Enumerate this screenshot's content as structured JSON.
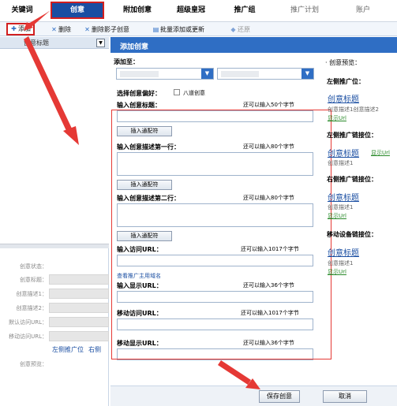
{
  "tabs": [
    {
      "label": "关键词"
    },
    {
      "label": "创意"
    },
    {
      "label": "附加创意"
    },
    {
      "label": "超级皇冠"
    },
    {
      "label": "推广组"
    },
    {
      "label": "推广计划"
    },
    {
      "label": "账户"
    }
  ],
  "toolbar": {
    "add": "添加",
    "delete": "删除",
    "delete_shadow": "删除影子创意",
    "batch": "批量添加或更新",
    "restore": "还原"
  },
  "left_panel": {
    "column_header": "创意标题",
    "form_labels": [
      "创意状态：",
      "创意标题：",
      "创意描述1：",
      "创意描述2：",
      "默认访问URL：",
      "移动访问URL："
    ],
    "tab_left": "左侧推广位",
    "tab_right": "右侧",
    "preview_label": "创意预览："
  },
  "modal": {
    "title": "添加创意",
    "add_to": "添加至：",
    "preference_label": "选择创意偏好：",
    "preference_option": "八道创意",
    "title_label": "输入创意标题：",
    "title_hint": "还可以输入50个字节",
    "insert_wildcard": "插入通配符",
    "desc1_label": "输入创意描述第一行：",
    "desc1_hint": "还可以输入80个字节",
    "desc2_label": "输入创意描述第二行：",
    "desc2_hint": "还可以输入80个字节",
    "visit_url_label": "输入访问URL：",
    "visit_url_hint": "还可以输入1017个字节",
    "check_domain": "查看推广主用域名",
    "display_url_label": "输入显示URL：",
    "display_url_hint": "还可以输入36个字节",
    "mobile_visit_label": "移动访问URL：",
    "mobile_visit_hint": "还可以输入1017个字节",
    "mobile_display_label": "移动显示URL：",
    "mobile_display_hint": "还可以输入36个字节"
  },
  "preview": {
    "header": "· 创意预览：",
    "sections": [
      {
        "title": "左侧推广位：",
        "headline": "创意标题",
        "desc": "创意描述1创意描述2",
        "url": "显示Url"
      },
      {
        "title": "左侧推广链接位：",
        "headline": "创意标题",
        "desc": "创意描述1",
        "url": "显示Url"
      },
      {
        "title": "右侧推广链接位：",
        "headline": "创意标题",
        "desc": "创意描述1",
        "url": "显示Url"
      },
      {
        "title": "移动设备链接位：",
        "headline": "创意标题",
        "desc": "创意描述1",
        "url": "显示Url"
      }
    ]
  },
  "footer": {
    "save": "保存创意",
    "cancel": "取消"
  },
  "colors": {
    "accent": "#2f6ec4",
    "active_tab": "#1a4ea2",
    "highlight": "#d21f1f",
    "link": "#1a4ea2",
    "url_green": "#2a8a2a"
  }
}
